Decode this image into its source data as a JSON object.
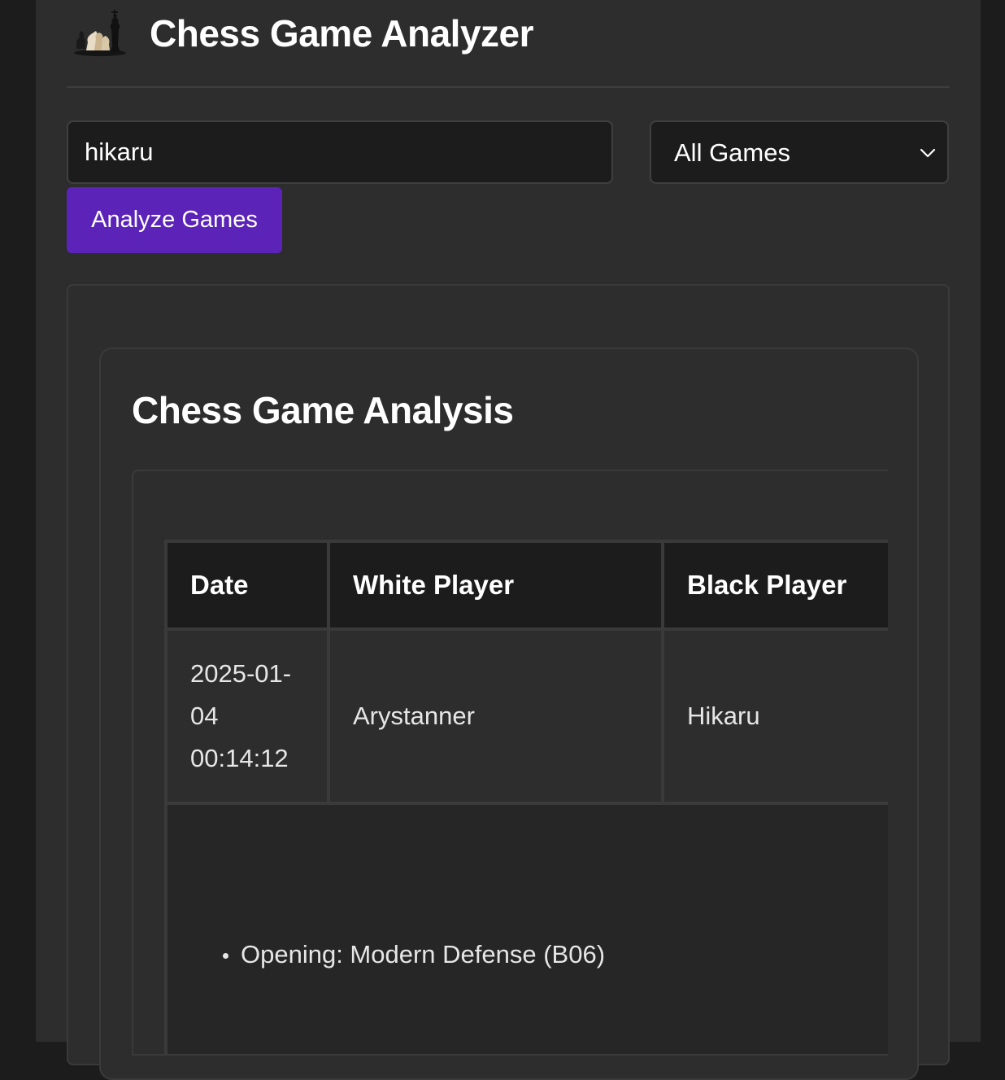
{
  "header": {
    "title": "Chess Game Analyzer",
    "logo_icon": "chess-pieces-logo"
  },
  "search": {
    "value": "hikaru",
    "placeholder": ""
  },
  "filter": {
    "selected": "All Games"
  },
  "actions": {
    "analyze_label": "Analyze Games"
  },
  "analysis": {
    "title": "Chess Game Analysis",
    "columns": [
      "Date",
      "White Player",
      "Black Player"
    ],
    "games": [
      {
        "date": "2025-01-04 00:14:12",
        "white": "Arystanner",
        "black": "Hikaru",
        "details": [
          "Opening: Modern Defense (B06)"
        ]
      }
    ]
  },
  "colors": {
    "accent": "#5b23b8",
    "background": "#2d2d2d",
    "input_bg": "#1c1c1c",
    "border": "#3a3a3a"
  }
}
